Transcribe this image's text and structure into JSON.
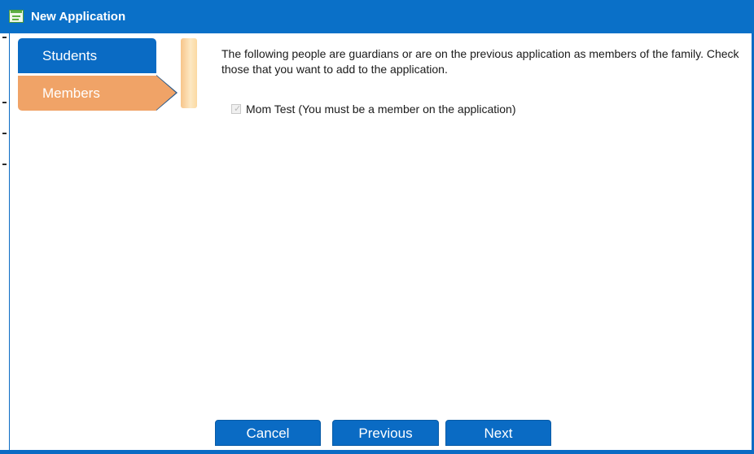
{
  "window": {
    "title": "New Application",
    "icon": "form-icon",
    "accent_color": "#0a6bc4"
  },
  "nav": {
    "items": [
      {
        "label": "Students",
        "state": "inactive",
        "color": "#0a6bc4"
      },
      {
        "label": "Members",
        "state": "active",
        "color": "#f0a367"
      }
    ]
  },
  "main": {
    "instructions": "The following people are guardians or are on the previous application as members of the family. Check those that you want to add to the application.",
    "members": [
      {
        "label": "Mom Test (You must be a member on the application)",
        "checked": true,
        "disabled": true
      }
    ]
  },
  "footer": {
    "cancel_label": "Cancel",
    "previous_label": "Previous",
    "next_label": "Next"
  }
}
